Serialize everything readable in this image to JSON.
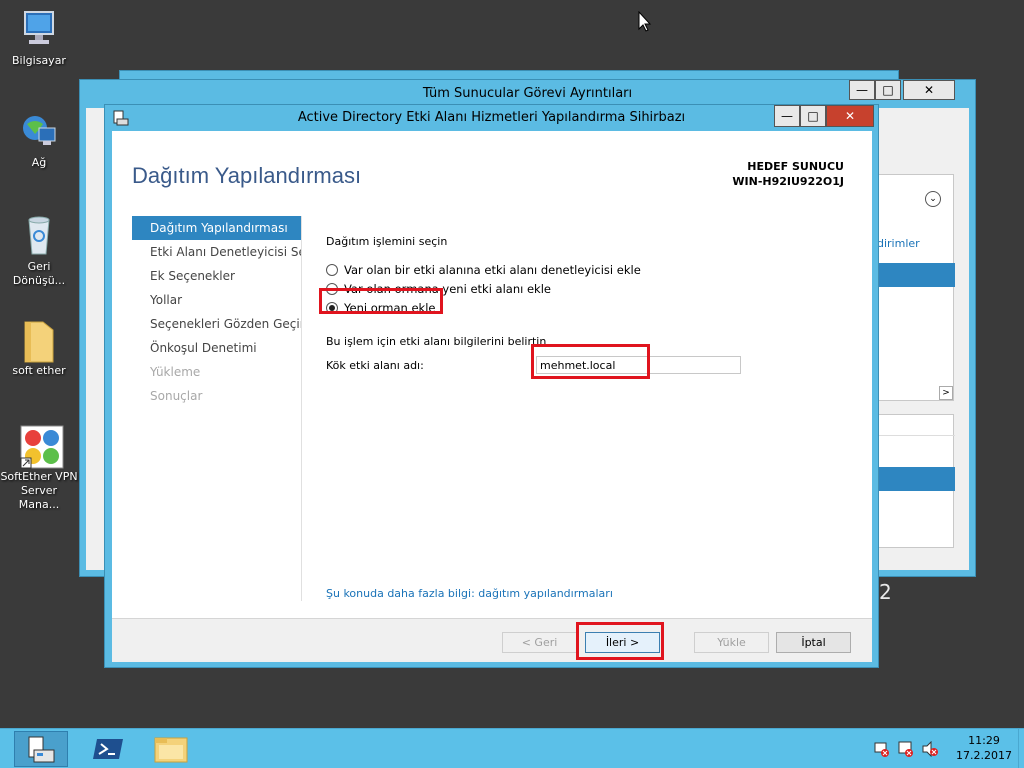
{
  "desktop": {
    "icons": [
      {
        "label": "Bilgisayar",
        "icon": "computer-icon"
      },
      {
        "label": "Ağ",
        "icon": "network-icon"
      },
      {
        "label": "Geri Dönüşü...",
        "icon": "recycle-bin-icon"
      },
      {
        "label": "soft ether",
        "icon": "folder-icon"
      },
      {
        "label": "SoftEther VPN Server Mana...",
        "icon": "softether-icon"
      }
    ]
  },
  "bg_window": {
    "title": "Tüm Sunucular Görevi Ayrıntıları",
    "partial_link": "dirimler",
    "partial_text": "2"
  },
  "wizard": {
    "title": "Active Directory Etki Alanı Hizmetleri Yapılandırma Sihirbazı",
    "page_title": "Dağıtım Yapılandırması",
    "target_label": "HEDEF SUNUCU",
    "target_server": "WIN-H92IU922O1J",
    "nav": [
      {
        "label": "Dağıtım Yapılandırması",
        "state": "active"
      },
      {
        "label": "Etki Alanı Denetleyicisi Se...",
        "state": "normal"
      },
      {
        "label": "Ek Seçenekler",
        "state": "normal"
      },
      {
        "label": "Yollar",
        "state": "normal"
      },
      {
        "label": "Seçenekleri Gözden Geçir",
        "state": "normal"
      },
      {
        "label": "Önkoşul Denetimi",
        "state": "normal"
      },
      {
        "label": "Yükleme",
        "state": "disabled"
      },
      {
        "label": "Sonuçlar",
        "state": "disabled"
      }
    ],
    "operation_label": "Dağıtım işlemini seçin",
    "options": [
      {
        "label": "Var olan bir etki alanına etki alanı denetleyicisi ekle",
        "checked": false
      },
      {
        "label": "Var olan ormana yeni etki alanı ekle",
        "checked": false
      },
      {
        "label": "Yeni orman ekle",
        "checked": true
      }
    ],
    "domain_info_label": "Bu işlem için etki alanı bilgilerini belirtin",
    "root_domain_label": "Kök etki alanı adı:",
    "root_domain_value": "mehmet.local",
    "more_info_link": "Şu konuda daha fazla bilgi: dağıtım yapılandırmaları",
    "buttons": {
      "back": "< Geri",
      "next": "İleri >",
      "install": "Yükle",
      "cancel": "İptal"
    }
  },
  "taskbar": {
    "time": "11:29",
    "date": "17.2.2017"
  },
  "colors": {
    "title_bar": "#5bbbe3",
    "nav_active": "#2e86c1",
    "highlight": "#e0141e",
    "link": "#1a73b8"
  }
}
